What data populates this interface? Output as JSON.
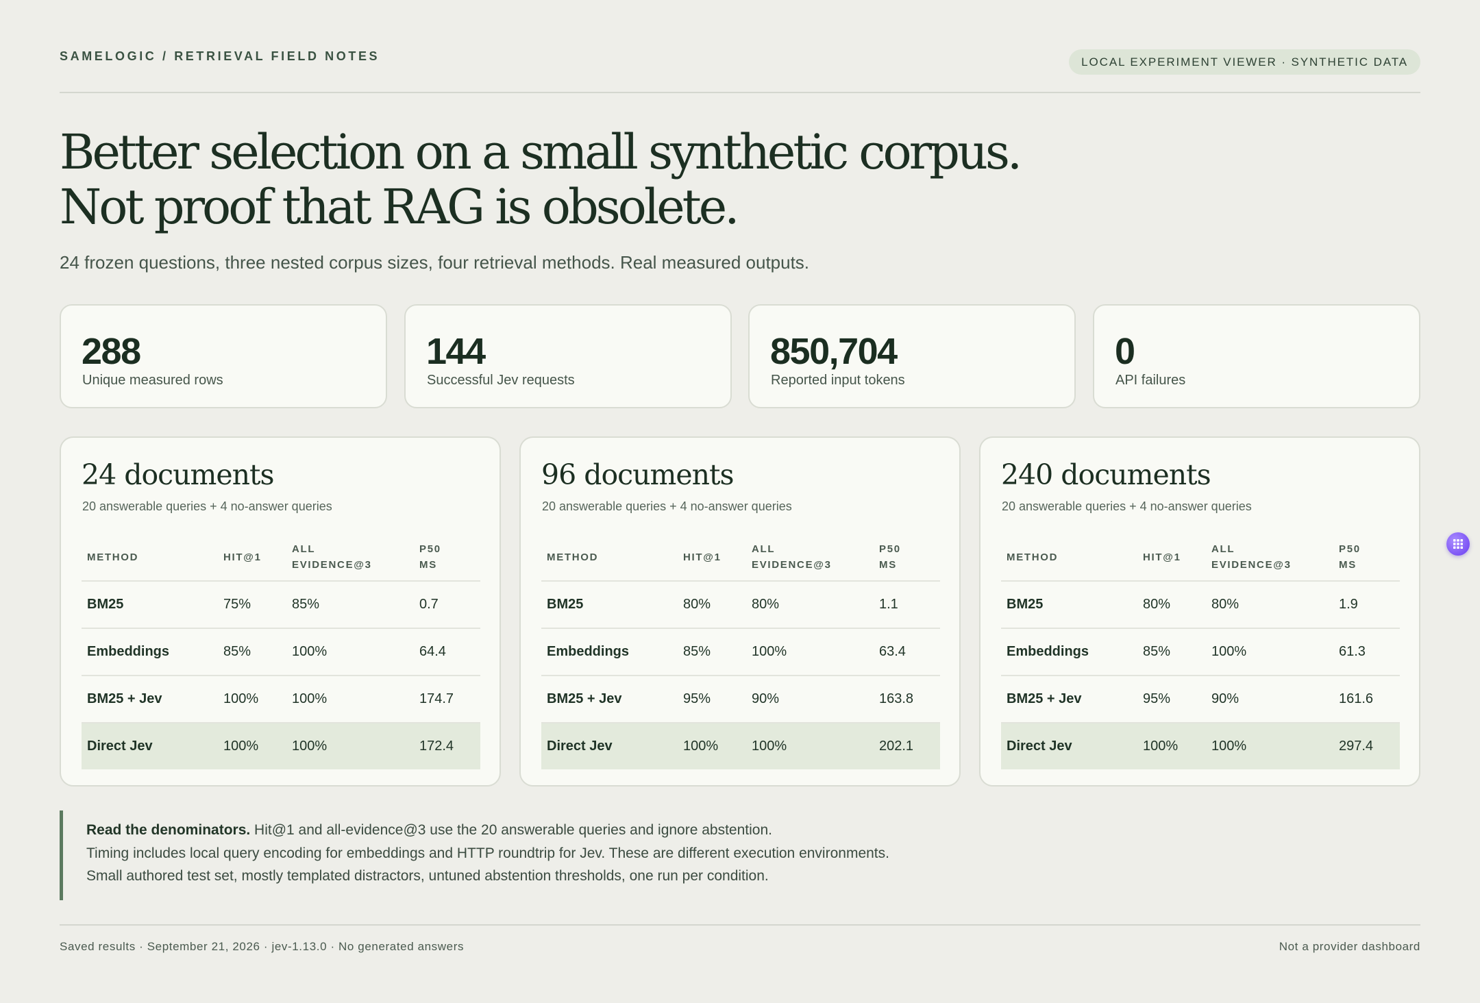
{
  "header": {
    "brand": "SAMELOGIC / RETRIEVAL FIELD NOTES",
    "badge": "LOCAL EXPERIMENT VIEWER · SYNTHETIC DATA"
  },
  "hero": {
    "line1": "Better selection on a small synthetic corpus.",
    "line2": "Not proof that RAG is obsolete.",
    "subtitle": "24 frozen questions, three nested corpus sizes, four retrieval methods. Real measured outputs."
  },
  "stats": [
    {
      "value": "288",
      "label": "Unique measured rows"
    },
    {
      "value": "144",
      "label": "Successful Jev requests"
    },
    {
      "value": "850,704",
      "label": "Reported input tokens"
    },
    {
      "value": "0",
      "label": "API failures"
    }
  ],
  "columns": {
    "method": "METHOD",
    "hit1": "HIT@1",
    "evidence_1": "ALL",
    "evidence_2": "EVIDENCE@3",
    "p50_1": "P50",
    "p50_2": "MS"
  },
  "panels": [
    {
      "title": "24 documents",
      "subtitle": "20 answerable queries + 4 no-answer queries",
      "rows": [
        {
          "method": "BM25",
          "hit1": "75%",
          "evidence": "85%",
          "p50": "0.7"
        },
        {
          "method": "Embeddings",
          "hit1": "85%",
          "evidence": "100%",
          "p50": "64.4"
        },
        {
          "method": "BM25 + Jev",
          "hit1": "100%",
          "evidence": "100%",
          "p50": "174.7"
        },
        {
          "method": "Direct Jev",
          "hit1": "100%",
          "evidence": "100%",
          "p50": "172.4"
        }
      ]
    },
    {
      "title": "96 documents",
      "subtitle": "20 answerable queries + 4 no-answer queries",
      "rows": [
        {
          "method": "BM25",
          "hit1": "80%",
          "evidence": "80%",
          "p50": "1.1"
        },
        {
          "method": "Embeddings",
          "hit1": "85%",
          "evidence": "100%",
          "p50": "63.4"
        },
        {
          "method": "BM25 + Jev",
          "hit1": "95%",
          "evidence": "90%",
          "p50": "163.8"
        },
        {
          "method": "Direct Jev",
          "hit1": "100%",
          "evidence": "100%",
          "p50": "202.1"
        }
      ]
    },
    {
      "title": "240 documents",
      "subtitle": "20 answerable queries + 4 no-answer queries",
      "rows": [
        {
          "method": "BM25",
          "hit1": "80%",
          "evidence": "80%",
          "p50": "1.9"
        },
        {
          "method": "Embeddings",
          "hit1": "85%",
          "evidence": "100%",
          "p50": "61.3"
        },
        {
          "method": "BM25 + Jev",
          "hit1": "95%",
          "evidence": "90%",
          "p50": "161.6"
        },
        {
          "method": "Direct Jev",
          "hit1": "100%",
          "evidence": "100%",
          "p50": "297.4"
        }
      ]
    }
  ],
  "notes": {
    "lead": "Read the denominators.",
    "line1": " Hit@1 and all-evidence@3 use the 20 answerable queries and ignore abstention.",
    "line2": "Timing includes local query encoding for embeddings and HTTP roundtrip for Jev. These are different execution environments.",
    "line3": "Small authored test set, mostly templated distractors, untuned abstention thresholds, one run per condition."
  },
  "footer": {
    "left": "Saved results · September 21, 2026 · jev-1.13.0 · No generated answers",
    "right": "Not a provider dashboard"
  },
  "widget": {
    "icon": "grid-icon"
  }
}
